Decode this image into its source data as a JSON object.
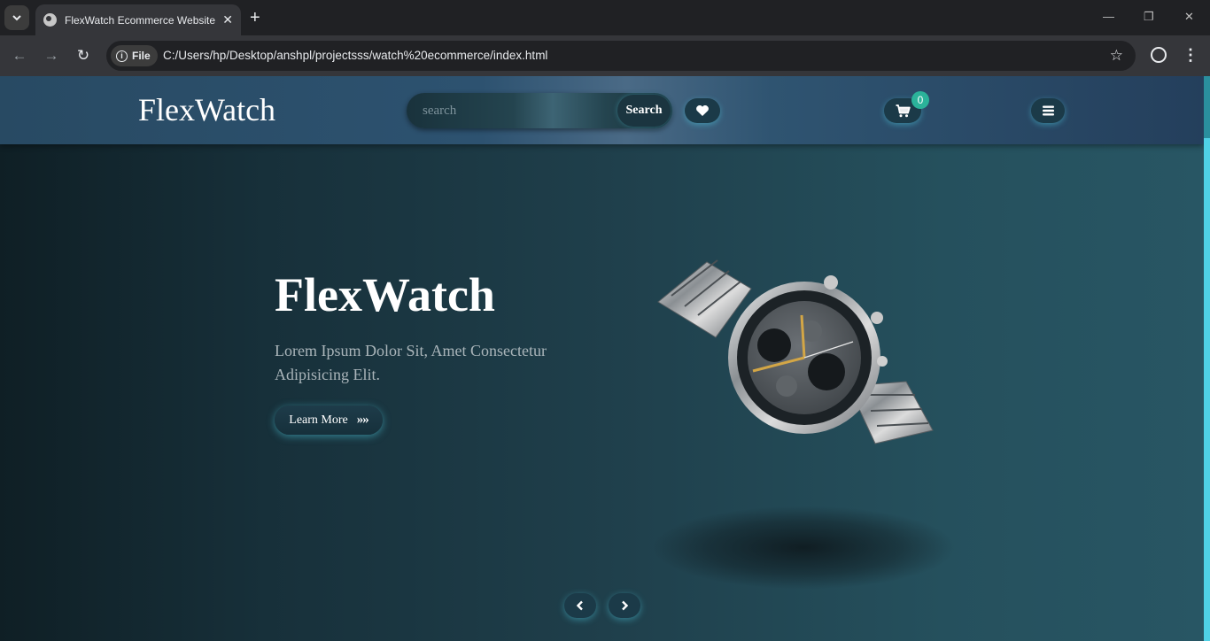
{
  "browser": {
    "tab_title": "FlexWatch Ecommerce Website",
    "file_chip": "File",
    "url": "C:/Users/hp/Desktop/anshpl/projectsss/watch%20ecommerce/index.html"
  },
  "site": {
    "logo": "FlexWatch",
    "search_placeholder": "search",
    "search_button": "Search",
    "cart_count": "0"
  },
  "hero": {
    "title": "FlexWatch",
    "subtitle": "Lorem Ipsum Dolor Sit, Amet Consectetur Adipisicing Elit.",
    "cta": "Learn More",
    "cta_arrows": "»»"
  },
  "icons": {
    "wishlist": "heart-icon",
    "cart": "cart-icon",
    "menu": "hamburger-icon",
    "prev": "chevron-left-icon",
    "next": "chevron-right-icon"
  },
  "colors": {
    "accent_glow": "#4fd1e6",
    "badge": "#2bb39a",
    "header": "#2d5270"
  }
}
